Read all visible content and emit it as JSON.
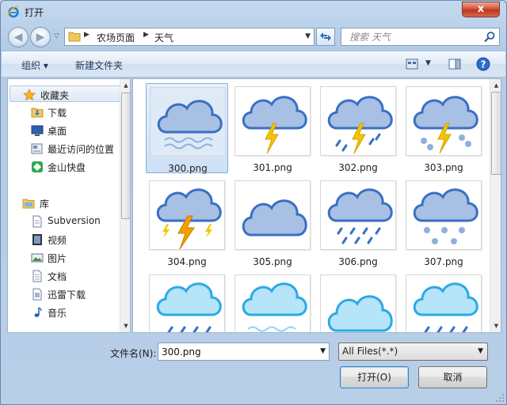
{
  "window": {
    "title": "打开",
    "close_label": "x"
  },
  "address": {
    "crumbs": [
      "农场页面",
      "天气"
    ]
  },
  "search": {
    "placeholder": "搜索 天气"
  },
  "toolbar": {
    "organize_label": "组织 ▾",
    "new_folder_label": "新建文件夹"
  },
  "nav": {
    "favorites": {
      "label": "收藏夹",
      "items": [
        "下载",
        "桌面",
        "最近访问的位置",
        "金山快盘"
      ]
    },
    "libraries": {
      "label": "库",
      "items": [
        "Subversion",
        "视频",
        "图片",
        "文档",
        "迅雷下载",
        "音乐"
      ]
    }
  },
  "files": [
    {
      "name": "300.png",
      "icon": "cloud-fog",
      "selected": true
    },
    {
      "name": "301.png",
      "icon": "cloud-thunder",
      "selected": false
    },
    {
      "name": "302.png",
      "icon": "cloud-thunder-rain",
      "selected": false
    },
    {
      "name": "303.png",
      "icon": "cloud-thunder-snow",
      "selected": false
    },
    {
      "name": "304.png",
      "icon": "cloud-thunder-storm",
      "selected": false
    },
    {
      "name": "305.png",
      "icon": "cloud",
      "selected": false
    },
    {
      "name": "306.png",
      "icon": "cloud-rain",
      "selected": false
    },
    {
      "name": "307.png",
      "icon": "cloud-snow",
      "selected": false
    },
    {
      "name": "",
      "icon": "cloud-rain-light",
      "selected": false
    },
    {
      "name": "",
      "icon": "cloud-fog-light",
      "selected": false
    },
    {
      "name": "",
      "icon": "cloud-light",
      "selected": false
    },
    {
      "name": "",
      "icon": "cloud-rain-light",
      "selected": false
    }
  ],
  "bottom": {
    "filename_label": "文件名(N):",
    "filename_value": "300.png",
    "filter_value": "All Files(*.*)",
    "open_label": "打开(O)",
    "cancel_label": "取消"
  },
  "colors": {
    "cloud_fill": "#a7c0e3",
    "cloud_stroke": "#3a6fc4",
    "cloud_light_fill": "#b6e4f8",
    "cloud_light_stroke": "#2aa9e6",
    "bolt": "#f3c500",
    "accent": "#3c7fb1"
  }
}
